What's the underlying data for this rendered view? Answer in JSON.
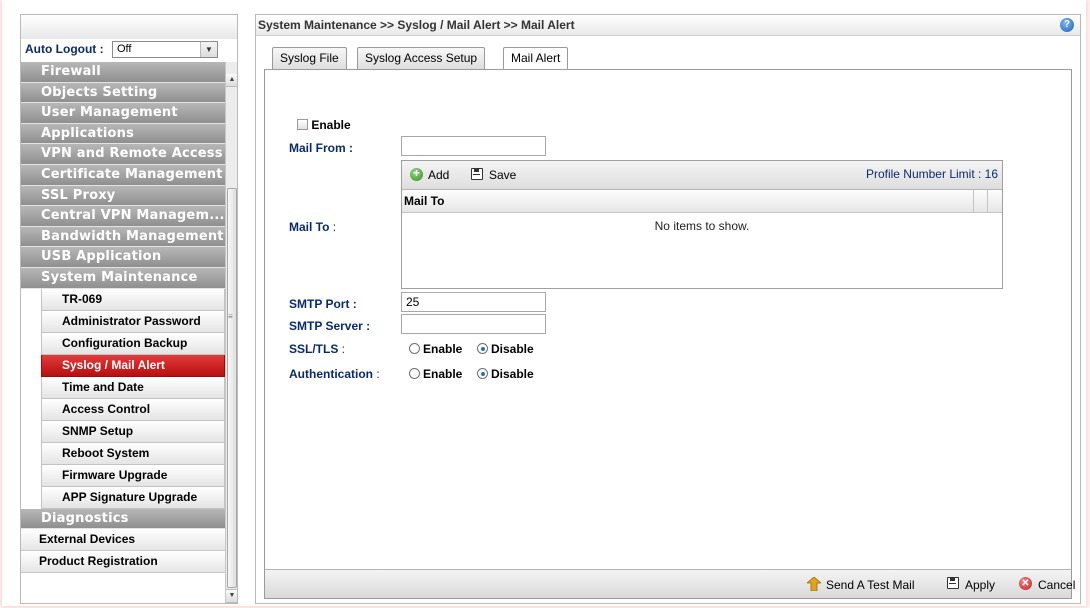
{
  "breadcrumb": "System Maintenance >> Syslog / Mail Alert >> Mail Alert",
  "auto_logout": {
    "label": "Auto Logout :",
    "value": "Off"
  },
  "sidebar": {
    "top_items": [
      "Firewall",
      "Objects Setting",
      "User Management",
      "Applications",
      "VPN and Remote Access",
      "Certificate Management",
      "SSL Proxy",
      "Central VPN Managem...",
      "Bandwidth Management",
      "USB Application",
      "System Maintenance"
    ],
    "sub_items": [
      "TR-069",
      "Administrator Password",
      "Configuration Backup",
      "Syslog / Mail Alert",
      "Time and Date",
      "Access Control",
      "SNMP Setup",
      "Reboot System",
      "Firmware Upgrade",
      "APP Signature Upgrade"
    ],
    "active_sub": "Syslog / Mail Alert",
    "diagnostics": "Diagnostics",
    "white_items": [
      "External Devices",
      "Product Registration"
    ]
  },
  "tabs": [
    "Syslog File",
    "Syslog Access Setup",
    "Mail Alert"
  ],
  "active_tab": "Mail Alert",
  "form": {
    "enable_label": "Enable",
    "enable_checked": false,
    "mail_from_label": "Mail From :",
    "mail_from_value": "",
    "mail_to_label": "Mail To",
    "mail_to_sep": " :",
    "add_label": "Add",
    "save_label": "Save",
    "profile_limit": "Profile Number Limit : 16",
    "mail_to_header": "Mail To",
    "empty_text": "No items to show.",
    "smtp_port_label": "SMTP Port :",
    "smtp_port_value": "25",
    "smtp_server_label": "SMTP Server :",
    "smtp_server_value": "",
    "ssl_label": "SSL/TLS",
    "ssl_sep": " :",
    "auth_label": "Authentication",
    "auth_sep": " :",
    "enable_opt": "Enable",
    "disable_opt": "Disable",
    "ssl_selected": "Disable",
    "auth_selected": "Disable"
  },
  "footer": {
    "send_test": "Send A Test Mail",
    "apply": "Apply",
    "cancel": "Cancel"
  },
  "colors": {
    "label_blue": "#0b2a6e",
    "active_red": "#c81a1a",
    "menu_gray": "#a3a3a3"
  },
  "icons": [
    "help-icon",
    "add-icon",
    "save-icon",
    "send-mail-icon",
    "apply-icon",
    "cancel-icon"
  ]
}
